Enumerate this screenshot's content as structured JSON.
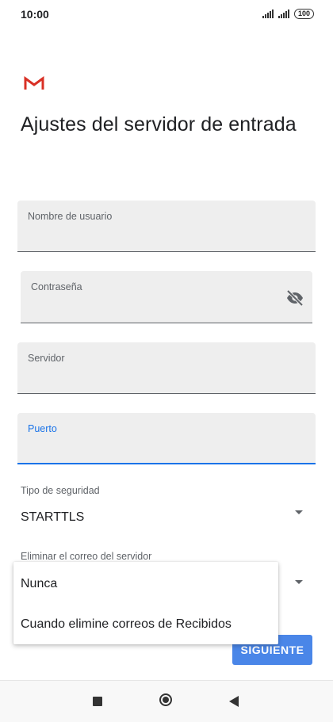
{
  "status_bar": {
    "time": "10:00",
    "battery": "100"
  },
  "page": {
    "title": "Ajustes del servidor de entrada"
  },
  "fields": {
    "username": {
      "label": "Nombre de usuario",
      "value": ""
    },
    "password": {
      "label": "Contraseña",
      "value": ""
    },
    "server": {
      "label": "Servidor",
      "value": ""
    },
    "port": {
      "label": "Puerto",
      "value": ""
    }
  },
  "security": {
    "label": "Tipo de seguridad",
    "value": "STARTTLS"
  },
  "delete_mail": {
    "label": "Eliminar el correo del servidor"
  },
  "dropdown_options": [
    "Nunca",
    "Cuando elimine correos de Recibidos"
  ],
  "buttons": {
    "next": "SIGUIENTE"
  },
  "icons": {
    "logo": "gmail-logo",
    "password_toggle": "eye-off-icon",
    "nav": [
      "recents-icon",
      "home-icon",
      "back-icon"
    ]
  },
  "colors": {
    "accent": "#1a73e8",
    "button": "#4a86e8",
    "gmail_red": "#d93025"
  }
}
